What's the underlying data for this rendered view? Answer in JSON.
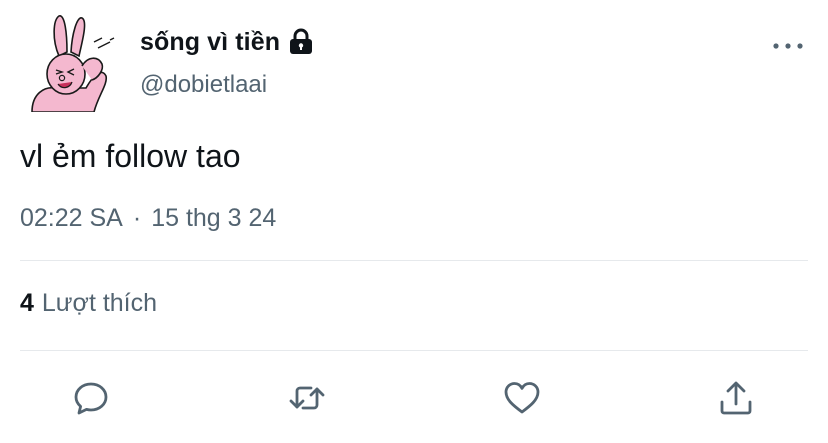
{
  "tweet": {
    "display_name": "sống vì tiền",
    "handle": "@dobietlaai",
    "text": "vl ẻm follow tao",
    "time": "02:22 SA",
    "separator": "·",
    "date": "15 thg 3 24",
    "likes": {
      "count": "4",
      "label": "Lượt thích"
    },
    "protected": true
  },
  "icons": {
    "lock": "lock-icon",
    "more": "more-horizontal-icon",
    "reply": "reply-bubble-icon",
    "retweet": "retweet-icon",
    "like": "heart-icon",
    "share": "share-upload-icon"
  },
  "colors": {
    "text_primary": "#0f1419",
    "text_secondary": "#536471",
    "divider": "#e6e9ec",
    "avatar_pink": "#f4b8cf"
  }
}
